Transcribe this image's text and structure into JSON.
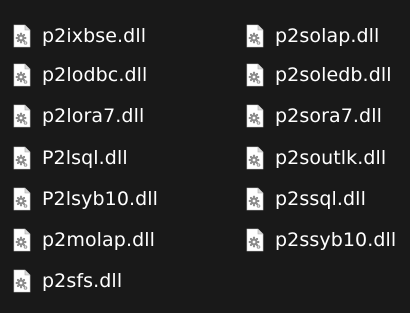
{
  "colors": {
    "background": "#191919",
    "text": "#ffffff",
    "icon_page": "#ffffff",
    "icon_gear": "#8a8a8a"
  },
  "files": [
    {
      "name": "p2ixbse.dll",
      "icon": "dll-file-icon"
    },
    {
      "name": "p2lodbc.dll",
      "icon": "dll-file-icon"
    },
    {
      "name": "p2lora7.dll",
      "icon": "dll-file-icon"
    },
    {
      "name": "P2lsql.dll",
      "icon": "dll-file-icon"
    },
    {
      "name": "P2lsyb10.dll",
      "icon": "dll-file-icon"
    },
    {
      "name": "p2molap.dll",
      "icon": "dll-file-icon"
    },
    {
      "name": "p2sfs.dll",
      "icon": "dll-file-icon"
    },
    {
      "name": "p2solap.dll",
      "icon": "dll-file-icon"
    },
    {
      "name": "p2soledb.dll",
      "icon": "dll-file-icon"
    },
    {
      "name": "p2sora7.dll",
      "icon": "dll-file-icon"
    },
    {
      "name": "p2soutlk.dll",
      "icon": "dll-file-icon"
    },
    {
      "name": "p2ssql.dll",
      "icon": "dll-file-icon"
    },
    {
      "name": "p2ssyb10.dll",
      "icon": "dll-file-icon"
    }
  ]
}
